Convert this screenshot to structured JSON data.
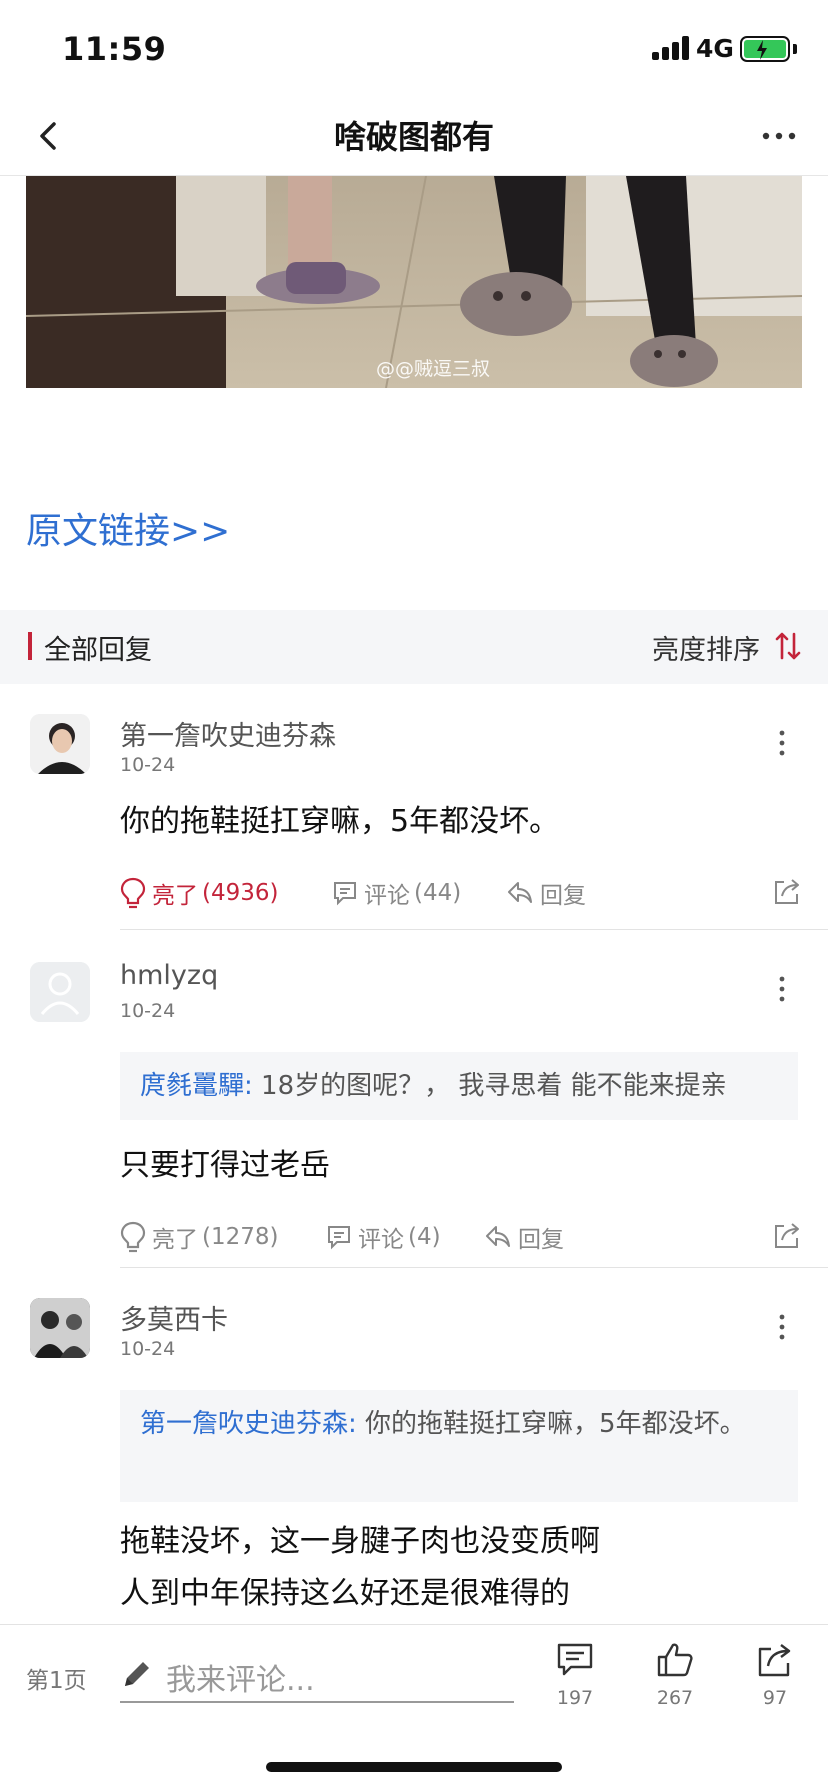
{
  "status_bar": {
    "time": "11:59",
    "network": "4G"
  },
  "nav": {
    "title": "啥破图都有"
  },
  "post": {
    "watermark": "@@贼逗三叔",
    "link_text": "原文链接>>"
  },
  "section": {
    "title": "全部回复",
    "sort_label": "亮度排序"
  },
  "comments": [
    {
      "username": "第一詹吹史迪芬森",
      "date": "10-24",
      "text": "你的拖鞋挺扛穿嘛，5年都没坏。",
      "light_label": "亮了",
      "light_count": "(4936)",
      "comment_label": "评论",
      "comment_count": "(44)",
      "reply_label": "回复"
    },
    {
      "username": "hmlyzq",
      "date": "10-24",
      "quote_author": "庹毵鼍驒:",
      "quote_text": " 18岁的图呢？， 我寻思着 能不能来提亲",
      "text": "只要打得过老岳",
      "light_label": "亮了",
      "light_count": "(1278)",
      "comment_label": "评论",
      "comment_count": "(4)",
      "reply_label": "回复"
    },
    {
      "username": "多莫西卡",
      "date": "10-24",
      "quote_author": "第一詹吹史迪芬森:",
      "quote_text": " 你的拖鞋挺扛穿嘛，5年都没坏。",
      "text_line1": "拖鞋没坏，这一身腱子肉也没变质啊",
      "text_line2": "人到中年保持这么好还是很难得的"
    }
  ],
  "bottom_bar": {
    "page_label": "第1页",
    "comment_placeholder": "我来评论...",
    "comments_count": "197",
    "likes_count": "267",
    "shares_count": "97"
  },
  "colors": {
    "accent_red": "#c3243a",
    "link_blue": "#2f6fd1",
    "battery_green": "#34c759"
  }
}
